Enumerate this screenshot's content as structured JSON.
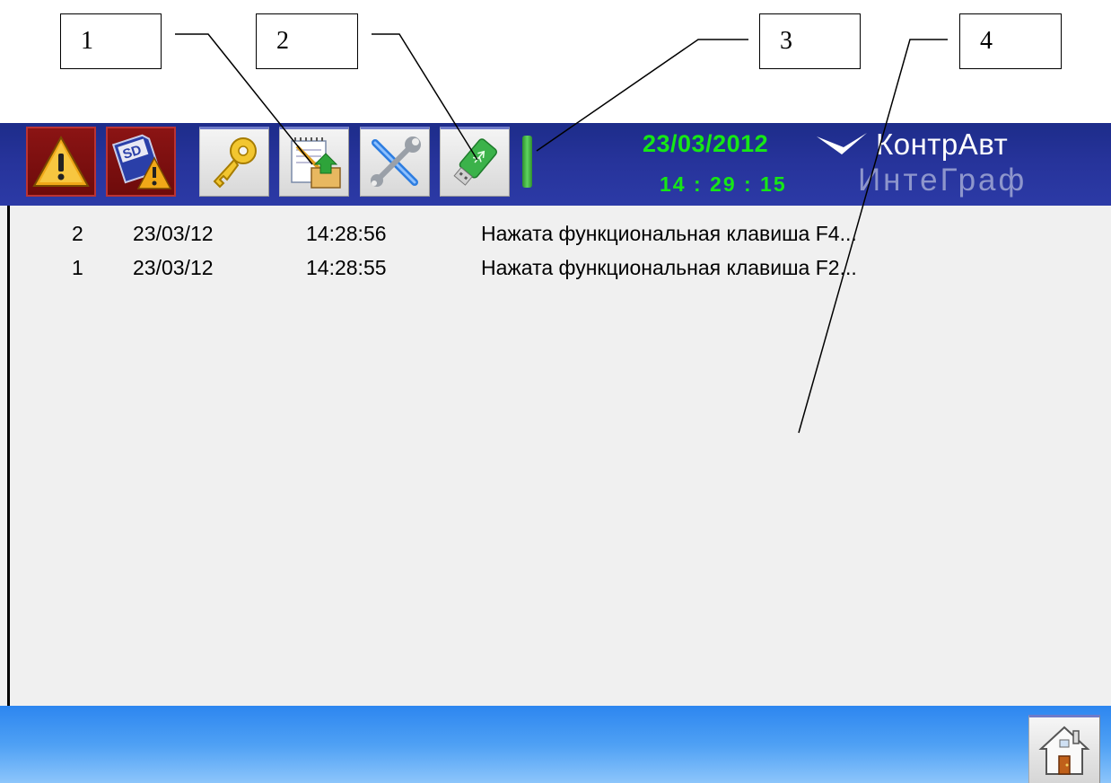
{
  "callouts": [
    "1",
    "2",
    "3",
    "4"
  ],
  "header": {
    "date": "23/03/2012",
    "time": "14 : 29 : 15",
    "brand_top": "КонтрАвт",
    "brand_bottom": "ИнтеГраф"
  },
  "toolbar": {
    "buttons": [
      {
        "icon": "alarm-warning-icon"
      },
      {
        "icon": "sd-card-warning-icon"
      },
      {
        "icon": "key-icon"
      },
      {
        "icon": "notepad-export-icon"
      },
      {
        "icon": "tools-icon"
      },
      {
        "icon": "usb-drive-icon"
      }
    ]
  },
  "log": {
    "rows": [
      {
        "num": "2",
        "date": "23/03/12",
        "time": "14:28:56",
        "message": "Нажата функциональная клавиша F4..."
      },
      {
        "num": "1",
        "date": "23/03/12",
        "time": "14:28:55",
        "message": "Нажата функциональная клавиша F2..."
      }
    ]
  },
  "colors": {
    "toolbar": "#26339a",
    "clock": "#16e716",
    "log_background": "#f0f0f0",
    "bottom_bar": "#4ea0f4"
  },
  "bottom": {
    "home_icon": "home-icon"
  }
}
